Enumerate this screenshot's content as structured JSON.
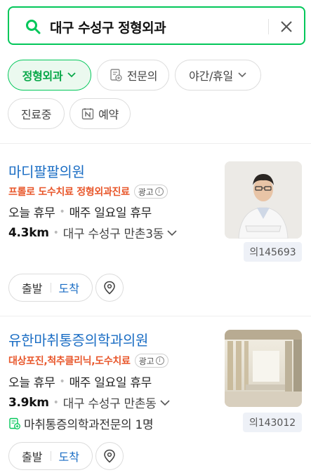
{
  "search": {
    "query": "대구 수성구 정형외과",
    "search_icon": "search-icon",
    "clear_icon": "close-icon"
  },
  "filters": {
    "chips": [
      {
        "label": "정형외과",
        "active": true,
        "icon": "chevron-down-icon"
      },
      {
        "label": "전문의",
        "active": false,
        "icon": "doctor-badge-icon"
      },
      {
        "label": "야간/휴일",
        "active": false,
        "icon": "chevron-down-icon"
      },
      {
        "label": "진료중",
        "active": false
      },
      {
        "label": "예약",
        "active": false,
        "icon": "naver-booking-icon"
      }
    ]
  },
  "results": [
    {
      "name": "마디팔팔의원",
      "ad_text": "프롤로 도수치료 정형외과진료",
      "ad_badge": "광고",
      "status": "오늘 휴무",
      "hours": "매주 일요일 휴무",
      "distance": "4.3km",
      "address": "대구 수성구 만촌3동",
      "id_badge": "의145693",
      "route_start": "출발",
      "route_arrive": "도착"
    },
    {
      "name": "유한마취통증의학과의원",
      "ad_text": "대상포진,척추클리닉,도수치료",
      "ad_badge": "광고",
      "status": "오늘 휴무",
      "hours": "매주 일요일 휴무",
      "distance": "3.9km",
      "address": "대구 수성구 만촌동",
      "specialist": "마취통증의학과전문의 1명",
      "id_badge": "의143012",
      "route_start": "출발",
      "route_arrive": "도착"
    }
  ],
  "colors": {
    "accent_green": "#03c75a",
    "link_blue": "#1a6dc4",
    "ad_orange": "#e8572b"
  }
}
